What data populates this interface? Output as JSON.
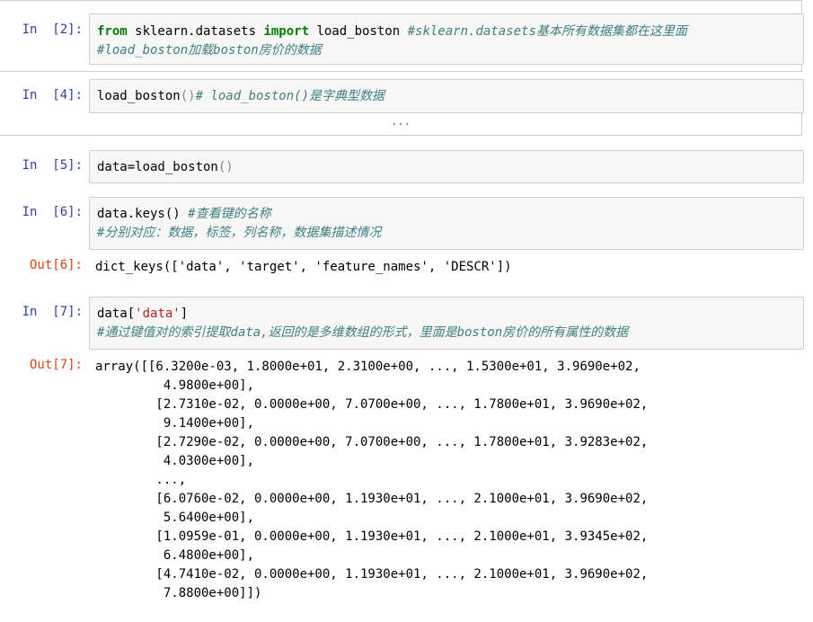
{
  "cells": [
    {
      "prompt": "In  [2]:",
      "lines": [
        [
          {
            "t": "from",
            "c": "kw"
          },
          {
            "t": " sklearn.datasets ",
            "c": ""
          },
          {
            "t": "import",
            "c": "kw"
          },
          {
            "t": " load_boston ",
            "c": ""
          },
          {
            "t": "#sklearn.datasets基本所有数据集都在这里面",
            "c": "cm"
          }
        ],
        [
          {
            "t": "#load_boston加载boston房价的数据",
            "c": "cm"
          }
        ]
      ]
    },
    {
      "prompt": "In  [4]:",
      "lines": [
        [
          {
            "t": "load_boston",
            "c": ""
          },
          {
            "t": "()",
            "c": "paren"
          },
          {
            "t": "# load_boston()是字典型数据",
            "c": "cm"
          }
        ]
      ],
      "collapsed_output": "..."
    },
    {
      "prompt": "In  [5]:",
      "lines": [
        [
          {
            "t": "data=load_boston",
            "c": ""
          },
          {
            "t": "()",
            "c": "paren"
          }
        ]
      ]
    },
    {
      "prompt": "In  [6]:",
      "lines": [
        [
          {
            "t": "data.keys() ",
            "c": ""
          },
          {
            "t": "#查看键的名称",
            "c": "cm"
          }
        ],
        [
          {
            "t": "#分别对应：数据，标签，列名称，数据集描述情况",
            "c": "cm"
          }
        ]
      ],
      "out_prompt": "Out[6]:",
      "output": "dict_keys(['data', 'target', 'feature_names', 'DESCR'])"
    },
    {
      "prompt": "In  [7]:",
      "lines": [
        [
          {
            "t": "data[",
            "c": ""
          },
          {
            "t": "'data'",
            "c": "str"
          },
          {
            "t": "]",
            "c": ""
          }
        ],
        [
          {
            "t": "#通过键值对的索引提取data,返回的是多维数组的形式，里面是boston房价的所有属性的数据",
            "c": "cm"
          }
        ]
      ],
      "out_prompt": "Out[7]:",
      "output": "array([[6.3200e-03, 1.8000e+01, 2.3100e+00, ..., 1.5300e+01, 3.9690e+02,\n         4.9800e+00],\n        [2.7310e-02, 0.0000e+00, 7.0700e+00, ..., 1.7800e+01, 3.9690e+02,\n         9.1400e+00],\n        [2.7290e-02, 0.0000e+00, 7.0700e+00, ..., 1.7800e+01, 3.9283e+02,\n         4.0300e+00],\n        ...,\n        [6.0760e-02, 0.0000e+00, 1.1930e+01, ..., 2.1000e+01, 3.9690e+02,\n         5.6400e+00],\n        [1.0959e-01, 0.0000e+00, 1.1930e+01, ..., 2.1000e+01, 3.9345e+02,\n         6.4800e+00],\n        [4.7410e-02, 0.0000e+00, 1.1930e+01, ..., 2.1000e+01, 3.9690e+02,\n         7.8800e+00]])"
    }
  ]
}
